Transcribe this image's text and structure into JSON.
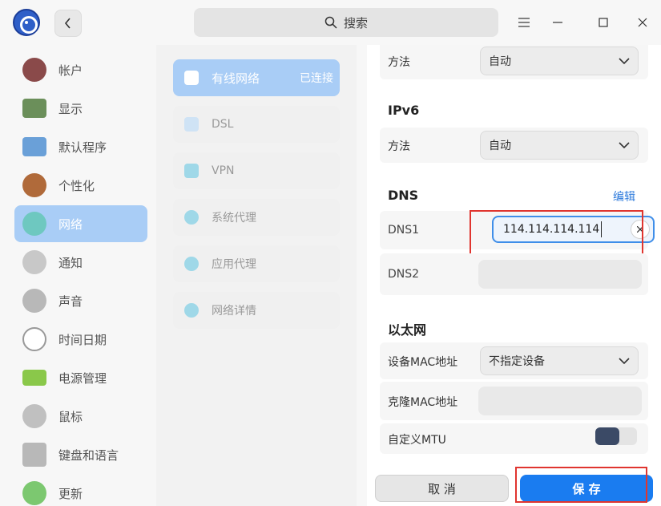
{
  "titlebar": {
    "search_placeholder": "搜索"
  },
  "sidebar": {
    "items": [
      {
        "label": "帐户",
        "icon": "account-icon",
        "color": "#8a4a4a"
      },
      {
        "label": "显示",
        "icon": "display-icon",
        "color": "#6b8f5a"
      },
      {
        "label": "默认程序",
        "icon": "default-apps-icon",
        "color": "#6aa0d8"
      },
      {
        "label": "个性化",
        "icon": "palette-icon",
        "color": "#b06a3a"
      },
      {
        "label": "网络",
        "icon": "network-icon",
        "color": "#6ec8c0"
      },
      {
        "label": "通知",
        "icon": "bell-icon",
        "color": "#c8c8c8"
      },
      {
        "label": "声音",
        "icon": "speaker-icon",
        "color": "#b8b8b8"
      },
      {
        "label": "时间日期",
        "icon": "clock-icon",
        "color": "#d8d8d8"
      },
      {
        "label": "电源管理",
        "icon": "battery-icon",
        "color": "#8ac84a"
      },
      {
        "label": "鼠标",
        "icon": "mouse-icon",
        "color": "#c0c0c0"
      },
      {
        "label": "键盘和语言",
        "icon": "keyboard-icon",
        "color": "#b8b8b8"
      },
      {
        "label": "更新",
        "icon": "update-icon",
        "color": "#7cc870"
      }
    ]
  },
  "network_list": {
    "items": [
      {
        "label": "有线网络",
        "status": "已连接",
        "icon": "wired-icon"
      },
      {
        "label": "DSL",
        "icon": "dsl-icon"
      },
      {
        "label": "VPN",
        "icon": "vpn-icon"
      },
      {
        "label": "系统代理",
        "icon": "system-proxy-icon"
      },
      {
        "label": "应用代理",
        "icon": "app-proxy-icon"
      },
      {
        "label": "网络详情",
        "icon": "info-icon"
      }
    ]
  },
  "settings": {
    "ipv4_method_label": "方法",
    "ipv4_method_value": "自动",
    "ipv6_title": "IPv6",
    "ipv6_method_label": "方法",
    "ipv6_method_value": "自动",
    "dns_title": "DNS",
    "dns_edit": "编辑",
    "dns1_label": "DNS1",
    "dns1_value": "114.114.114.114",
    "dns2_label": "DNS2",
    "dns2_value": "",
    "ethernet_title": "以太网",
    "mac_label": "设备MAC地址",
    "mac_value": "不指定设备",
    "clone_mac_label": "克隆MAC地址",
    "clone_mac_value": "",
    "mtu_label": "自定义MTU",
    "mtu_enabled": false
  },
  "actions": {
    "cancel": "取 消",
    "save": "保 存"
  },
  "colors": {
    "accent": "#1a7cf0",
    "active_item": "#a9cdf6",
    "highlight": "#e0352f"
  }
}
